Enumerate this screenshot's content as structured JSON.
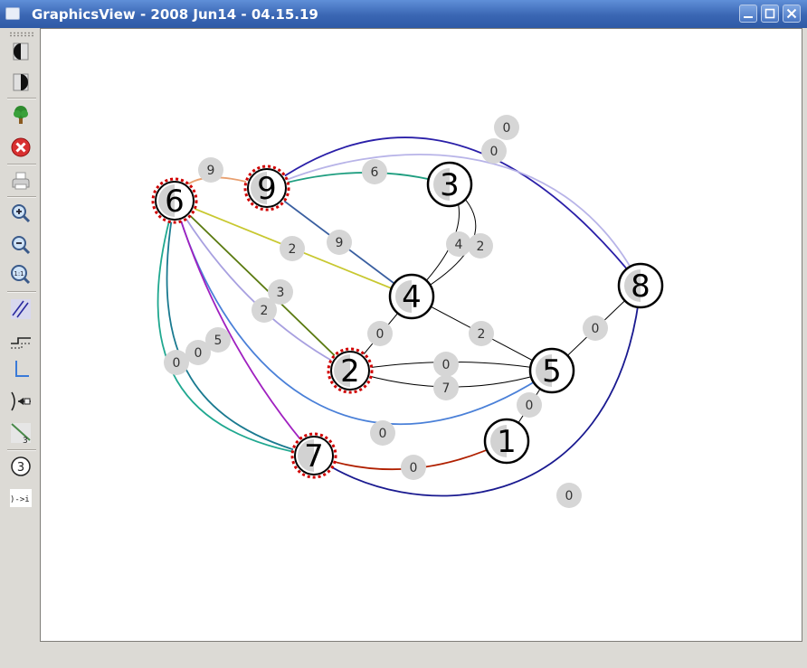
{
  "window": {
    "title": "GraphicsView - 2008 Jun14 - 04.15.19",
    "icon": "app-icon",
    "controls": [
      "minimize-icon",
      "maximize-icon",
      "close-icon"
    ]
  },
  "toolbar": {
    "buttons": [
      {
        "icon": "move-left-icon"
      },
      {
        "icon": "move-right-icon"
      },
      {
        "icon": "tree-icon"
      },
      {
        "icon": "delete-icon"
      },
      {
        "icon": "print-icon"
      },
      {
        "icon": "zoom-in-icon"
      },
      {
        "icon": "zoom-out-icon"
      },
      {
        "icon": "zoom-reset-icon",
        "text": "1:1"
      },
      {
        "icon": "edge-style-icon"
      },
      {
        "icon": "route-icon"
      },
      {
        "icon": "axis-icon"
      },
      {
        "icon": "arrow-head-icon"
      },
      {
        "icon": "edge-weight-icon",
        "text": "3"
      },
      {
        "icon": "node-label-icon",
        "text": "3"
      },
      {
        "icon": "arrow-text-icon",
        "text": ")->i"
      }
    ]
  },
  "graph": {
    "nodes": [
      {
        "id": "6",
        "selected": true
      },
      {
        "id": "9",
        "selected": true
      },
      {
        "id": "3",
        "selected": false
      },
      {
        "id": "4",
        "selected": false
      },
      {
        "id": "8",
        "selected": false
      },
      {
        "id": "2",
        "selected": true
      },
      {
        "id": "5",
        "selected": false
      },
      {
        "id": "1",
        "selected": false
      },
      {
        "id": "7",
        "selected": true
      }
    ],
    "edges": [
      {
        "from": "6",
        "to": "9",
        "weight": "9",
        "color": "#e8a070"
      },
      {
        "from": "9",
        "to": "3",
        "weight": "6",
        "color": "#1f9e80"
      },
      {
        "from": "9",
        "to": "8",
        "weight": "0",
        "color": "#2a1fa8"
      },
      {
        "from": "9",
        "to": "8",
        "weight": "0",
        "color": "#b8b4e8"
      },
      {
        "from": "9",
        "to": "4",
        "weight": "9",
        "color": "#3a5fa0"
      },
      {
        "from": "3",
        "to": "4",
        "weight": "4",
        "color": "#000000"
      },
      {
        "from": "3",
        "to": "4",
        "weight": "2",
        "color": "#000000"
      },
      {
        "from": "6",
        "to": "4",
        "weight": "2",
        "color": "#c8c830"
      },
      {
        "from": "6",
        "to": "2",
        "weight": "3",
        "color": "#5a7a10"
      },
      {
        "from": "6",
        "to": "2",
        "weight": "2",
        "color": "#a8a0e0"
      },
      {
        "from": "6",
        "to": "5",
        "weight": "0",
        "color": "#4a80d8"
      },
      {
        "from": "6",
        "to": "7",
        "weight": "5",
        "color": "#a020c0"
      },
      {
        "from": "6",
        "to": "7",
        "weight": "0",
        "color": "#1a7a90"
      },
      {
        "from": "6",
        "to": "7",
        "weight": "0",
        "color": "#20a890"
      },
      {
        "from": "4",
        "to": "2",
        "weight": "0",
        "color": "#000000"
      },
      {
        "from": "4",
        "to": "5",
        "weight": "2",
        "color": "#000000"
      },
      {
        "from": "2",
        "to": "5",
        "weight": "0",
        "color": "#000000"
      },
      {
        "from": "2",
        "to": "5",
        "weight": "7",
        "color": "#000000"
      },
      {
        "from": "8",
        "to": "5",
        "weight": "0",
        "color": "#000000"
      },
      {
        "from": "5",
        "to": "1",
        "weight": "0",
        "color": "#000000"
      },
      {
        "from": "7",
        "to": "1",
        "weight": "0",
        "color": "#b02000"
      },
      {
        "from": "7",
        "to": "8",
        "weight": "0",
        "color": "#1a1a90"
      }
    ]
  }
}
